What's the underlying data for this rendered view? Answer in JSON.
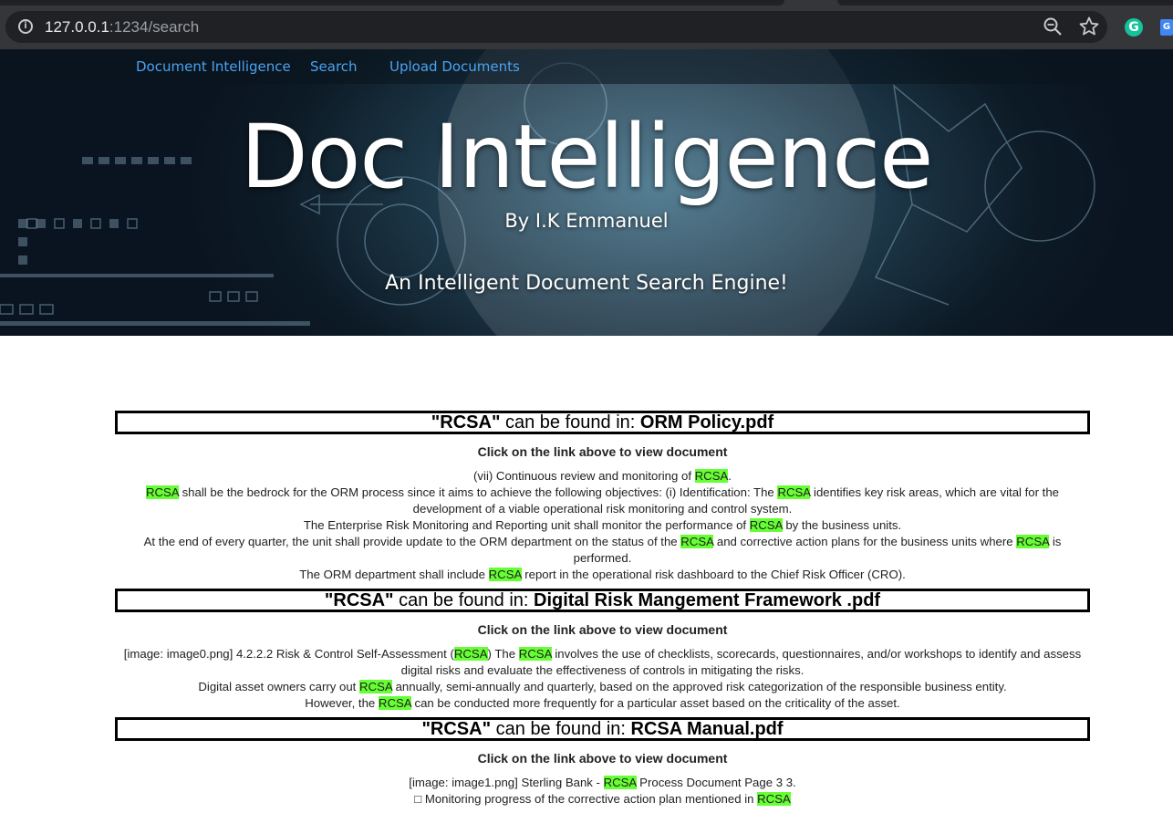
{
  "browser": {
    "url_host": "127.0.0.1",
    "url_rest": ":1234/search",
    "info_icon": "info-icon",
    "zoom_icon": "zoom-out-icon",
    "star_icon": "bookmark-star-icon",
    "extension_grammarly": "G",
    "extension_translate": "G"
  },
  "nav": {
    "items": [
      "Document Intelligence",
      "Search",
      "Upload Documents"
    ]
  },
  "hero": {
    "title": "Doc Intelligence",
    "byline": "By I.K Emmanuel",
    "tagline": "An Intelligent Document Search Engine!"
  },
  "results": {
    "query": "\"RCSA\"",
    "found_in": " can be found in: ",
    "click_note": "Click on the link above to view document",
    "items": [
      {
        "file": "ORM Policy.pdf",
        "snippets": [
          [
            "(vii) Continuous review and monitoring of ",
            "RCSA",
            "."
          ],
          [
            "",
            "RCSA",
            " shall be the bedrock for the ORM process since it aims to achieve the following objectives: (i) Identification: The ",
            "RCSA",
            " identifies key risk areas, which are vital for the development of a viable operational risk monitoring and control system."
          ],
          [
            "The Enterprise Risk Monitoring and Reporting unit shall monitor the performance of ",
            "RCSA",
            " by the business units."
          ],
          [
            "At the end of every quarter, the unit shall provide update to the ORM department on the status of the ",
            "RCSA",
            " and corrective action plans for the business units where ",
            "RCSA",
            " is performed."
          ],
          [
            "The ORM department shall include ",
            "RCSA",
            " report in the operational risk dashboard to the Chief Risk Officer (CRO)."
          ]
        ]
      },
      {
        "file": "Digital Risk Mangement Framework .pdf",
        "snippets": [
          [
            "[image: image0.png] 4.2.2.2 Risk & Control Self-Assessment (",
            "RCSA",
            ") The ",
            "RCSA",
            " involves the use of checklists, scorecards, questionnaires, and/or workshops to identify and assess digital risks and evaluate the effectiveness of controls in mitigating the risks."
          ],
          [
            "Digital asset owners carry out ",
            "RCSA",
            " annually, semi-annually and quarterly, based on the approved risk categorization of the responsible business entity."
          ],
          [
            "However, the ",
            "RCSA",
            " can be conducted more frequently for a particular asset based on the criticality of the asset."
          ]
        ]
      },
      {
        "file": "RCSA Manual.pdf",
        "snippets": [
          [
            "[image: image1.png] Sterling Bank - ",
            "RCSA",
            " Process Document Page 3 3."
          ],
          [
            "□ Monitoring progress of the corrective action plan mentioned in ",
            "RCSA",
            ""
          ]
        ]
      }
    ]
  }
}
